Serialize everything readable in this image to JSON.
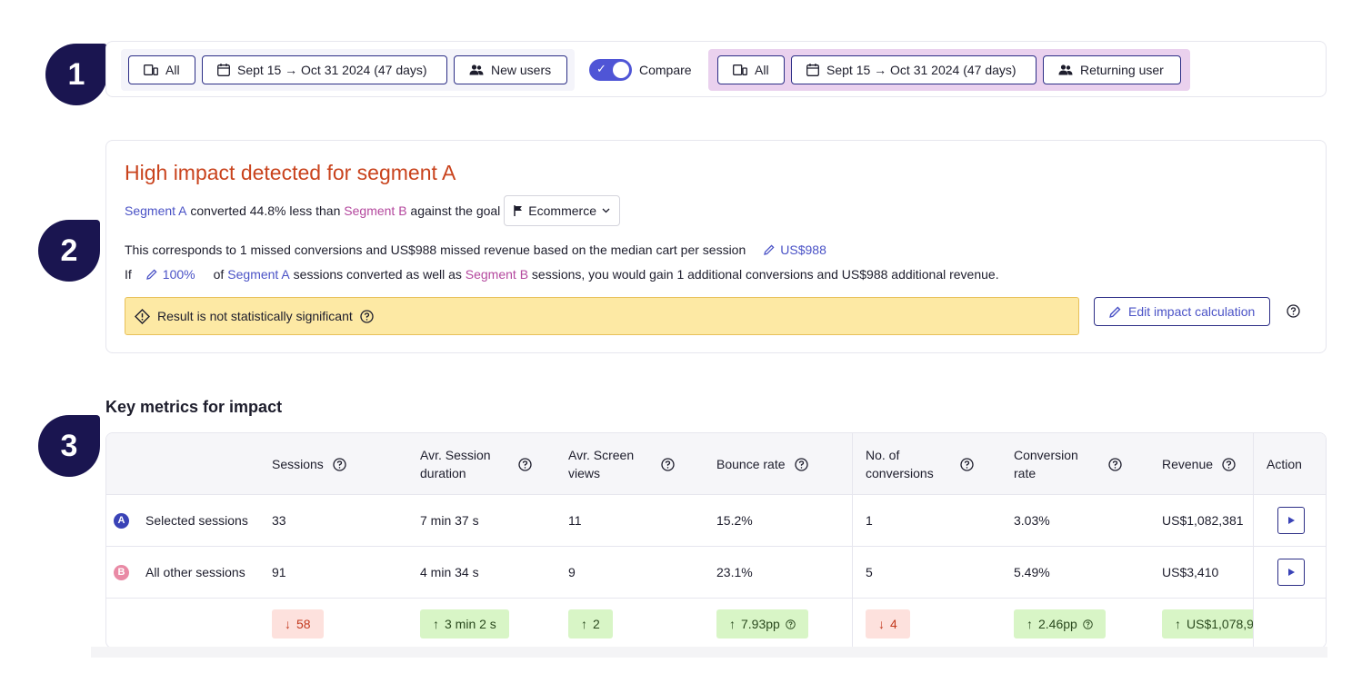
{
  "steps": [
    "1",
    "2",
    "3"
  ],
  "filters": {
    "segment_a": {
      "device": "All",
      "date_range": "Sept 15 → Oct 31 2024 (47 days)",
      "audience": "New users"
    },
    "compare_label": "Compare",
    "compare_enabled": true,
    "segment_b": {
      "device": "All",
      "date_range": "Sept 15 → Oct 31 2024 (47 days)",
      "audience": "Returning user"
    }
  },
  "impact": {
    "title": "High impact detected for segment A",
    "segment_a": "Segment A",
    "segment_b": "Segment B",
    "line1_mid": " converted 44.8% less than ",
    "line1_end": " against the goal",
    "goal": "Ecommerce",
    "line2": "This corresponds to 1 missed conversions and US$988 missed revenue based on the median cart per session",
    "median_cart": "US$988",
    "line3_if": "If",
    "percent": "100%",
    "line3_of": "of",
    "line3_mid": " sessions converted as well as ",
    "line3_end": " sessions, you would gain 1 additional conversions and US$988 additional revenue.",
    "warning": "Result is not statistically significant",
    "edit_button": "Edit impact calculation"
  },
  "metrics": {
    "title": "Key metrics for impact",
    "columns": [
      "Sessions",
      "Avr. Session duration",
      "Avr. Screen views",
      "Bounce rate",
      "No. of conversions",
      "Conversion rate",
      "Revenue",
      "Action"
    ],
    "rows": [
      {
        "badge": "A",
        "label": "Selected sessions",
        "values": [
          "33",
          "7 min 37 s",
          "11",
          "15.2%",
          "1",
          "3.03%",
          "US$1,082,381"
        ]
      },
      {
        "badge": "B",
        "label": "All other sessions",
        "values": [
          "91",
          "4 min 34 s",
          "9",
          "23.1%",
          "5",
          "5.49%",
          "US$3,410"
        ]
      }
    ],
    "deltas": [
      {
        "text": "58",
        "dir": "down"
      },
      {
        "text": "3 min 2 s",
        "dir": "up"
      },
      {
        "text": "2",
        "dir": "up"
      },
      {
        "text": "7.93pp",
        "dir": "up"
      },
      {
        "text": "4",
        "dir": "down"
      },
      {
        "text": "2.46pp",
        "dir": "up"
      },
      {
        "text": "US$1,078,9",
        "dir": "up"
      }
    ]
  },
  "colors": {
    "accent": "#4a52c6",
    "segment_b": "#b4489e",
    "danger": "#c9431d",
    "warning_bg": "#fde9a4",
    "badge_bg": "#1a1550"
  }
}
